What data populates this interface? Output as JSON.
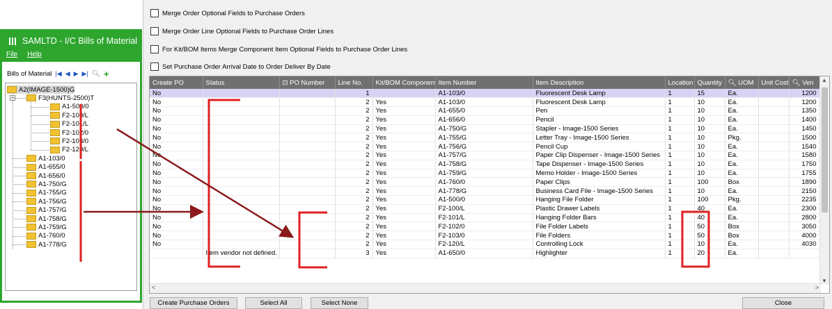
{
  "options": [
    {
      "label": "Merge Order Optional Fields to Purchase Orders",
      "checked": false
    },
    {
      "label": "Merge Order Line Optional Fields to Purchase Order Lines",
      "checked": false
    },
    {
      "label": "For Kit/BOM Items Merge Component Item Optional Fields to Purchase Order Lines",
      "checked": false
    },
    {
      "label": "Set Purchase Order Arrival Date to Order Deliver By Date",
      "checked": false
    }
  ],
  "grid": {
    "columns": [
      "Create PO",
      "Status",
      "PO Number",
      "Line No.",
      "Kit/BOM Component",
      "Item Number",
      "Item Description",
      "Location",
      "Quantity",
      "UOM",
      "Unit Cost",
      "Ven"
    ],
    "rows": [
      [
        "No",
        "",
        "",
        "1",
        "",
        "A1-103/0",
        "Fluorescent Desk Lamp",
        "1",
        "15",
        "Ea.",
        "",
        "1200"
      ],
      [
        "No",
        "",
        "",
        "2",
        "Yes",
        "A1-103/0",
        "Fluorescent Desk Lamp",
        "1",
        "10",
        "Ea.",
        "",
        "1200"
      ],
      [
        "No",
        "",
        "",
        "2",
        "Yes",
        "A1-655/0",
        "Pen",
        "1",
        "10",
        "Ea.",
        "",
        "1350"
      ],
      [
        "No",
        "",
        "",
        "2",
        "Yes",
        "A1-656/0",
        "Pencil",
        "1",
        "10",
        "Ea.",
        "",
        "1400"
      ],
      [
        "No",
        "",
        "",
        "2",
        "Yes",
        "A1-750/G",
        "Stapler - Image-1500 Series",
        "1",
        "10",
        "Ea.",
        "",
        "1450"
      ],
      [
        "No",
        "",
        "",
        "2",
        "Yes",
        "A1-755/G",
        "Letter Tray - Image-1500 Series",
        "1",
        "10",
        "Pkg.",
        "",
        "1500"
      ],
      [
        "No",
        "",
        "",
        "2",
        "Yes",
        "A1-756/G",
        "Pencil Cup",
        "1",
        "10",
        "Ea.",
        "",
        "1540"
      ],
      [
        "No",
        "",
        "",
        "2",
        "Yes",
        "A1-757/G",
        "Paper Clip Dispenser - Image-1500 Series",
        "1",
        "10",
        "Ea.",
        "",
        "1580"
      ],
      [
        "No",
        "",
        "",
        "2",
        "Yes",
        "A1-758/G",
        "Tape Dispenser - Image-1500 Series",
        "1",
        "10",
        "Ea.",
        "",
        "1750"
      ],
      [
        "No",
        "",
        "",
        "2",
        "Yes",
        "A1-759/G",
        "Memo Holder - Image-1500 Series",
        "1",
        "10",
        "Ea.",
        "",
        "1755"
      ],
      [
        "No",
        "",
        "",
        "2",
        "Yes",
        "A1-760/0",
        "Paper Clips",
        "1",
        "100",
        "Box",
        "",
        "1890"
      ],
      [
        "No",
        "",
        "",
        "2",
        "Yes",
        "A1-778/G",
        "Business Card File - Image-1500 Series",
        "1",
        "10",
        "Ea.",
        "",
        "2150"
      ],
      [
        "No",
        "",
        "",
        "2",
        "Yes",
        "A1-500/0",
        "Hanging File Folder",
        "1",
        "100",
        "Pkg.",
        "",
        "2235"
      ],
      [
        "No",
        "",
        "",
        "2",
        "Yes",
        "F2-100/L",
        "Plastic Drawer Labels",
        "1",
        "40",
        "Ea.",
        "",
        "2300"
      ],
      [
        "No",
        "",
        "",
        "2",
        "Yes",
        "F2-101/L",
        "Hanging Folder Bars",
        "1",
        "40",
        "Ea.",
        "",
        "2800"
      ],
      [
        "No",
        "",
        "",
        "2",
        "Yes",
        "F2-102/0",
        "File Folder Labels",
        "1",
        "50",
        "Box",
        "",
        "3050"
      ],
      [
        "No",
        "",
        "",
        "2",
        "Yes",
        "F2-103/0",
        "File Folders",
        "1",
        "50",
        "Box",
        "",
        "4000"
      ],
      [
        "No",
        "",
        "",
        "2",
        "Yes",
        "F2-120/L",
        "Controlling Lock",
        "1",
        "10",
        "Ea.",
        "",
        "4030"
      ],
      [
        "",
        "Item vendor not defined.",
        "",
        "3",
        "Yes",
        "A1-650/0",
        "Highlighter",
        "1",
        "20",
        "Ea.",
        "",
        ""
      ]
    ]
  },
  "buttons": {
    "create_po": "Create Purchase Orders",
    "select_all": "Select All",
    "select_none": "Select None",
    "close": "Close"
  },
  "left_window": {
    "title": "SAMLTD - I/C Bills of Material",
    "menu": [
      "File",
      "Help"
    ],
    "toolbar_label": "Bills of Material",
    "tree": {
      "root": "A2(IMAGE-1500)G",
      "sub": "F3(HUNTS-2500)T",
      "sub_children": [
        "A1-500/0",
        "F2-100/L",
        "F2-101/L",
        "F2-102/0",
        "F2-103/0",
        "F2-120/L"
      ],
      "root_children": [
        "A1-103/0",
        "A1-655/0",
        "A1-656/0",
        "A1-750/G",
        "A1-755/G",
        "A1-756/G",
        "A1-757/G",
        "A1-758/G",
        "A1-759/G",
        "A1-760/0",
        "A1-778/G"
      ]
    }
  },
  "colors": {
    "window_green": "#2ea62e",
    "header_gray": "#707070",
    "selected_row": "#d6d3f5",
    "annotation_red": "#e02020",
    "annotation_arrow": "#8b1a1a"
  }
}
